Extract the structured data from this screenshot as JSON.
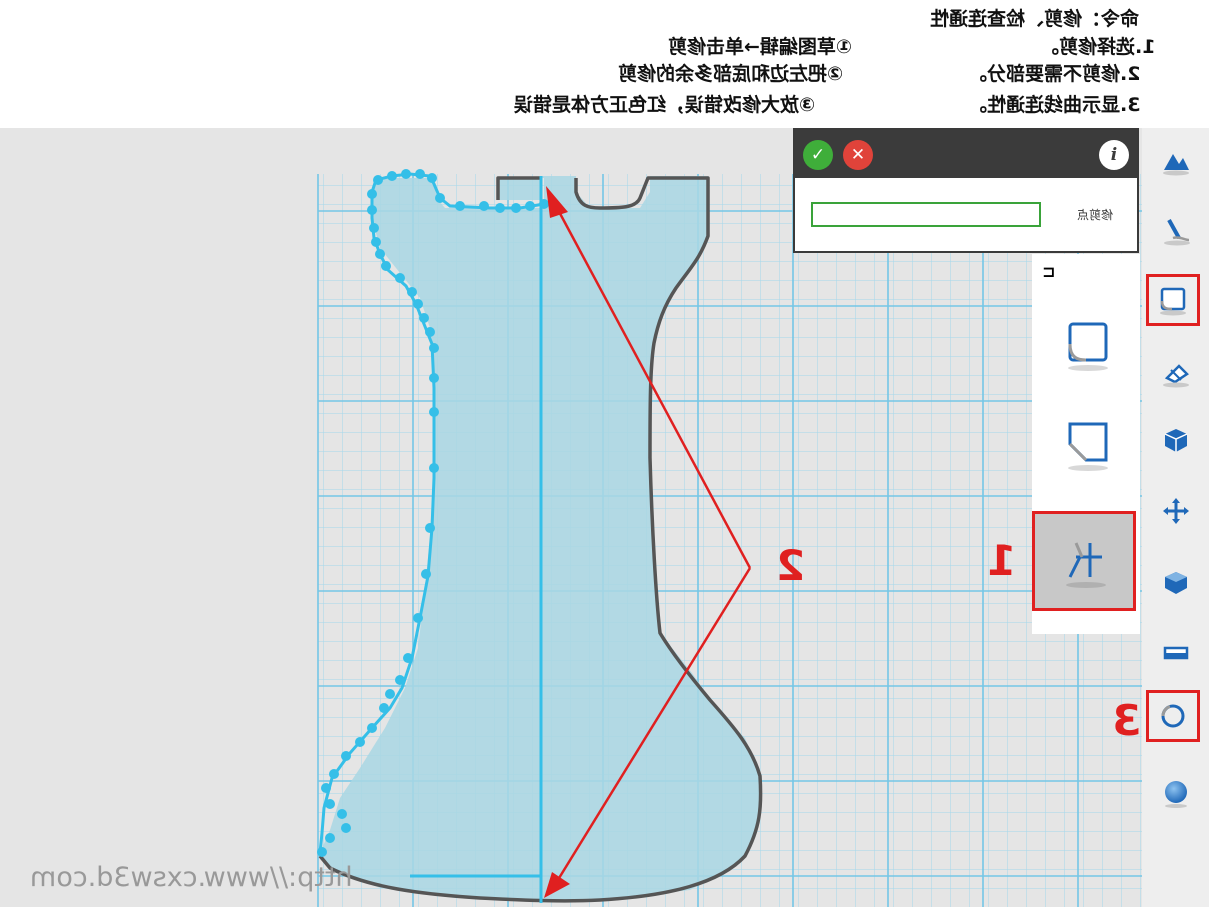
{
  "header": {
    "title": "命令：修剪、检查连通性",
    "step1": "1.选择修剪。",
    "step2": "2.修剪不需要部分。",
    "step3": "3.显示曲线连通性。",
    "note1": "①草图编辑→单击修剪",
    "note2": "②把左边和底部多余的修剪",
    "note3": "③放大修改错误，红色正方体是错误"
  },
  "dialog": {
    "ok_icon": "check-icon",
    "cancel_icon": "close-icon",
    "info_icon": "info-icon",
    "info_glyph": "i",
    "ok_glyph": "✓",
    "cancel_glyph": "✕",
    "field_label": "修剪点",
    "field_value": ""
  },
  "annotations": {
    "one": "1",
    "two": "2",
    "three": "3"
  },
  "watermark": "http://www.cxsw3d.com",
  "toolbar": {
    "items": [
      "cloud-shapes-icon",
      "pen-icon",
      "sketch-icon",
      "sketch-edit-icon",
      "solid-icon",
      "move-icon",
      "combine-icon",
      "measure-icon",
      "connectivity-icon",
      "material-icon"
    ]
  },
  "subpanel": {
    "items": [
      "sketch-rect-icon",
      "sketch-cut-icon",
      "trim-icon"
    ],
    "pin_glyph": "⊐"
  },
  "colors": {
    "accent_red": "#e02020",
    "shape_fill": "#a9d7e4",
    "curve_points": "#35bfe8",
    "grid": "#9cd6ec"
  }
}
